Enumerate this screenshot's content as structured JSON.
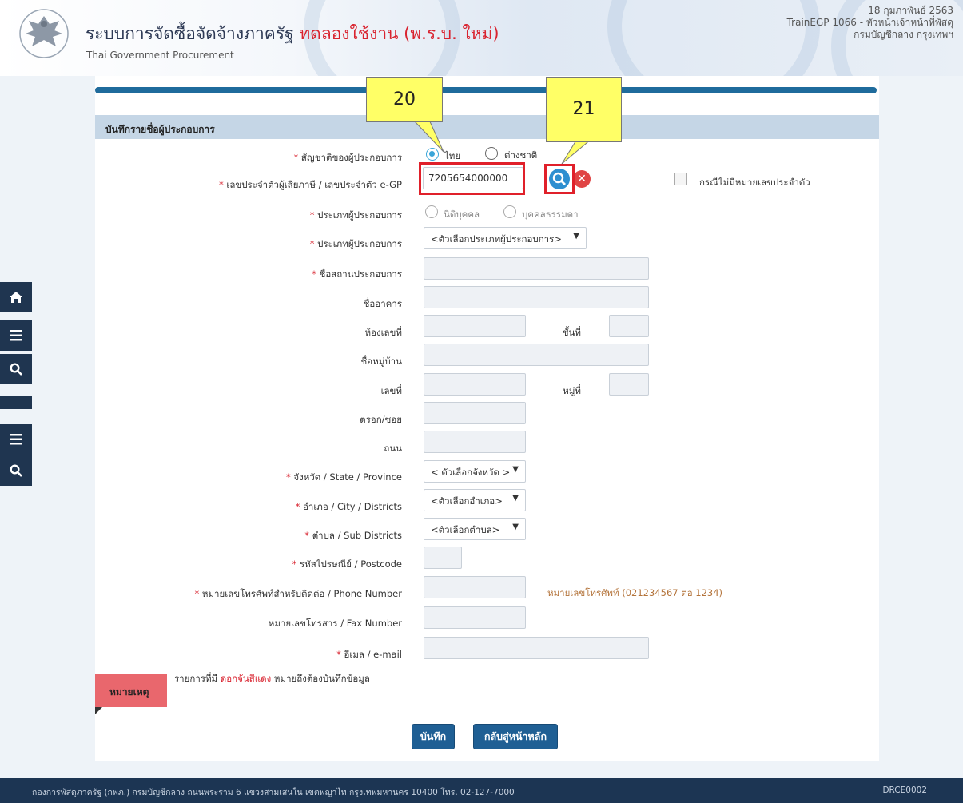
{
  "header": {
    "title_main": "ระบบการจัดซื้อจัดจ้างภาครัฐ",
    "title_trial": "ทดลองใช้งาน (พ.ร.บ. ใหม่)",
    "subtitle": "Thai Government Procurement",
    "date": "18 กุมภาพันธ์ 2563",
    "user": "TrainEGP 1066 - หัวหน้าเจ้าหน้าที่พัสดุ",
    "department": "กรมบัญชีกลาง กรุงเทพฯ"
  },
  "section": {
    "title": "บันทึกรายชื่อผู้ประกอบการ"
  },
  "form": {
    "nationality": {
      "label": "สัญชาติของผู้ประกอบการ",
      "option_thai": "ไทย",
      "option_foreign": "ต่างชาติ",
      "selected": "ไทย"
    },
    "tax_id": {
      "label": "เลขประจำตัวผู้เสียภาษี / เลขประจำตัว e-GP",
      "value": "7205654000000"
    },
    "no_id": {
      "label": "กรณีไม่มีหมายเลขประจำตัว"
    },
    "entity_type": {
      "label": "ประเภทผู้ประกอบการ",
      "option_juristic": "นิติบุคคล",
      "option_natural": "บุคคลธรรมดา"
    },
    "business_type": {
      "label": "ประเภทผู้ประกอบการ",
      "value": "<ตัวเลือกประเภทผู้ประกอบการ>"
    },
    "business_name": {
      "label": "ชื่อสถานประกอบการ",
      "value": ""
    },
    "building": {
      "label": "ชื่ออาคาร",
      "value": ""
    },
    "room_no": {
      "label": "ห้องเลขที่",
      "value": ""
    },
    "floor": {
      "label": "ชั้นที่",
      "value": ""
    },
    "village": {
      "label": "ชื่อหมู่บ้าน",
      "value": ""
    },
    "house_no": {
      "label": "เลขที่",
      "value": ""
    },
    "moo": {
      "label": "หมู่ที่",
      "value": ""
    },
    "soi": {
      "label": "ตรอก/ซอย",
      "value": ""
    },
    "road": {
      "label": "ถนน",
      "value": ""
    },
    "province": {
      "label": "จังหวัด / State / Province",
      "value": "< ตัวเลือกจังหวัด >"
    },
    "district": {
      "label": "อำเภอ / City / Districts",
      "value": "<ตัวเลือกอำเภอ>"
    },
    "subdistrict": {
      "label": "ตำบล / Sub Districts",
      "value": "<ตัวเลือกตำบล>"
    },
    "postcode": {
      "label": "รหัสไปรษณีย์ / Postcode",
      "value": ""
    },
    "phone": {
      "label": "หมายเลขโทรศัพท์สำหรับติดต่อ / Phone Number",
      "value": "",
      "hint": "หมายเลขโทรศัพท์ (021234567 ต่อ 1234)"
    },
    "fax": {
      "label": "หมายเลขโทรสาร / Fax Number",
      "value": ""
    },
    "email": {
      "label": "อีเมล / e-mail",
      "value": ""
    }
  },
  "note": {
    "tab": "หมายเหตุ",
    "prefix": "รายการที่มี",
    "highlight": "ดอกจันสีแดง",
    "suffix": "หมายถึงต้องบันทึกข้อมูล"
  },
  "buttons": {
    "save": "บันทึก",
    "back": "กลับสู่หน้าหลัก"
  },
  "callouts": {
    "first": "20",
    "second": "21"
  },
  "footer": {
    "text": "กองการพัสดุภาครัฐ (กพภ.) กรมบัญชีกลาง ถนนพระราม 6 แขวงสามเสนใน เขตพญาไท กรุงเทพมหานคร 10400 โทร. 02-127-7000",
    "code": "DRCE0002"
  },
  "colors": {
    "accent": "#1f5f94",
    "required": "#d9232f",
    "callout": "#ffff66",
    "highlight_box": "#e0202a"
  }
}
